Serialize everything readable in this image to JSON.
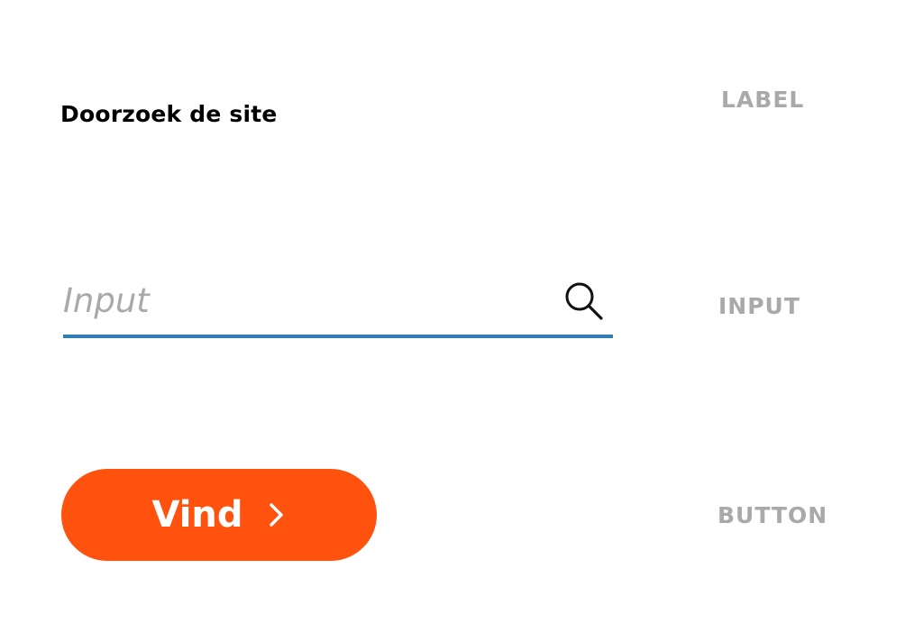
{
  "label": {
    "title": "Doorzoek de site"
  },
  "search": {
    "placeholder": "Input",
    "icon": "search-icon",
    "underline_color": "#2a7fc1"
  },
  "button": {
    "label": "Vind",
    "icon": "chevron-right-icon",
    "color": "#ff520e"
  },
  "annotations": {
    "label": "LABEL",
    "input": "INPUT",
    "button": "BUTTON"
  }
}
